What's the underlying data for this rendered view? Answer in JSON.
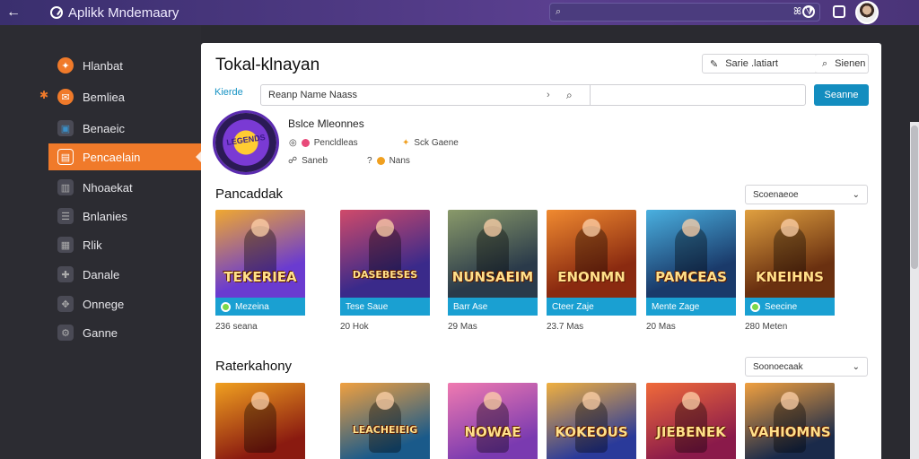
{
  "window": {
    "title": "Aplikk Mndemaary",
    "back_icon": "arrow-left-icon"
  },
  "topbar": {
    "search_placeholder": "",
    "search_btn_1": "ല",
    "search_btn_2": "ഴ"
  },
  "sidebar": {
    "items": [
      {
        "label": "Hlanbat",
        "icon": "orange-flame-icon",
        "color": "#f07a2a"
      },
      {
        "label": "Bemliea",
        "icon": "orange-chat-icon",
        "color": "#f07a2a"
      },
      {
        "label": "Benaeic",
        "icon": "box-icon",
        "color": "#3a8fc8"
      },
      {
        "label": "Pencaelain",
        "icon": "document-icon",
        "color": "#ffffff",
        "active": true
      },
      {
        "label": "Nhoaekat",
        "icon": "chart-icon",
        "color": "#aaaaaa"
      },
      {
        "label": "Bnlanies",
        "icon": "layers-icon",
        "color": "#aaaaaa"
      },
      {
        "label": "Rlik",
        "icon": "grid-icon",
        "color": "#aaaaaa"
      },
      {
        "label": "Danale",
        "icon": "puzzle-icon",
        "color": "#aaaaaa"
      },
      {
        "label": "Onnege",
        "icon": "gamepad-icon",
        "color": "#aaaaaa"
      },
      {
        "label": "Ganne",
        "icon": "settings-icon",
        "color": "#aaaaaa"
      }
    ]
  },
  "main": {
    "title": "Tokal-klnayan",
    "header_left_btn": "Sarie .latiart",
    "header_right_btn": "Sienen",
    "filter_label": "Kierde",
    "search_text": "Reanp    Name    Naass",
    "search_button": "Seanne",
    "featured": {
      "logo_text": "LEGENDS",
      "name": "Bslce Mleonnes",
      "meta1": "Pencldleas",
      "meta2": "Sck Gaene",
      "meta3": "Saneb",
      "meta4": "Nans"
    },
    "section1": {
      "title": "Pancaddak",
      "sort": "Scoenaeoe",
      "cards": [
        {
          "logo": "TEKERIEA",
          "bar": "Mezeina",
          "sub": "236 seana",
          "bg": "#6a3bd0",
          "bg2": "#f0a830",
          "bar_dot": true
        },
        {
          "logo": "DASEBESES",
          "bar": "Tese Saue",
          "sub": "20 Hok",
          "bg": "#3a2a8a",
          "bg2": "#d04a6a",
          "bar_dot": false
        },
        {
          "logo": "NUNSAEIM",
          "bar": "Barr Ase",
          "sub": "29 Mas",
          "bg": "#2a3a4a",
          "bg2": "#8a9a6a",
          "bar_dot": false
        },
        {
          "logo": "ENONMN",
          "bar": "Cteer Zaje",
          "sub": "23.7 Mas",
          "bg": "#8a2a10",
          "bg2": "#f08a30",
          "bar_dot": false
        },
        {
          "logo": "PAMCEAS",
          "bar": "Mente Zage",
          "sub": "20 Mas",
          "bg": "#1a3a6a",
          "bg2": "#4ab0e0",
          "bar_dot": false
        },
        {
          "logo": "KNEIHNS",
          "bar": "Seecine",
          "sub": "280 Meten",
          "bg": "#6a3010",
          "bg2": "#e0a040",
          "bar_dot": true
        }
      ]
    },
    "section2": {
      "title": "Raterkahony",
      "sort": "Soonoecaak",
      "cards": [
        {
          "logo": "",
          "bg": "#8a1a10",
          "bg2": "#f0a020"
        },
        {
          "logo": "LEACHEIEIG",
          "bg": "#1a5a8a",
          "bg2": "#f0a040"
        },
        {
          "logo": "NOWAE",
          "bg": "#7a3ab0",
          "bg2": "#f07ab0"
        },
        {
          "logo": "KOKEOUS",
          "bg": "#2a3a9a",
          "bg2": "#f0b040"
        },
        {
          "logo": "JIEBENEK",
          "bg": "#8a1a4a",
          "bg2": "#f06a3a"
        },
        {
          "logo": "VAHIOMNS",
          "bg": "#1a2a4a",
          "bg2": "#f0a040"
        }
      ]
    }
  }
}
